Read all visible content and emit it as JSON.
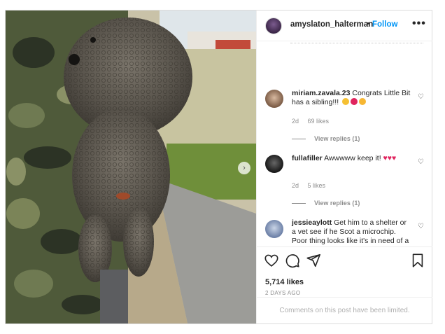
{
  "post": {
    "author": "amyslaton_halterman",
    "follow_label": "Follow",
    "separator": "•",
    "more_label": "•••",
    "likes": "5,714 likes",
    "posted": "2 DAYS AGO",
    "comments_limited": "Comments on this post have been limited."
  },
  "comments": [
    {
      "user": "miriam.zavala.23",
      "text": "Congrats Little Bit has a sibling!!!",
      "time": "2d",
      "likes": "69 likes",
      "replies": "View replies (1)"
    },
    {
      "user": "fullafiller",
      "text": "Awwwww keep it!",
      "time": "2d",
      "likes": "5 likes",
      "replies": "View replies (1)"
    },
    {
      "user": "jessieaylott",
      "text": "Get him to a shelter or a vet see if he Scot a microchip. Poor thing looks like it's in need of a"
    }
  ],
  "icons": {
    "like": "heart-icon",
    "comment": "comment-icon",
    "share": "paper-plane-icon",
    "save": "bookmark-icon",
    "carousel": "chevron-right-icon"
  },
  "colors": {
    "follow": "#0095f6",
    "heart_emoji": "#e0245e",
    "muted": "#8e8e8e"
  }
}
